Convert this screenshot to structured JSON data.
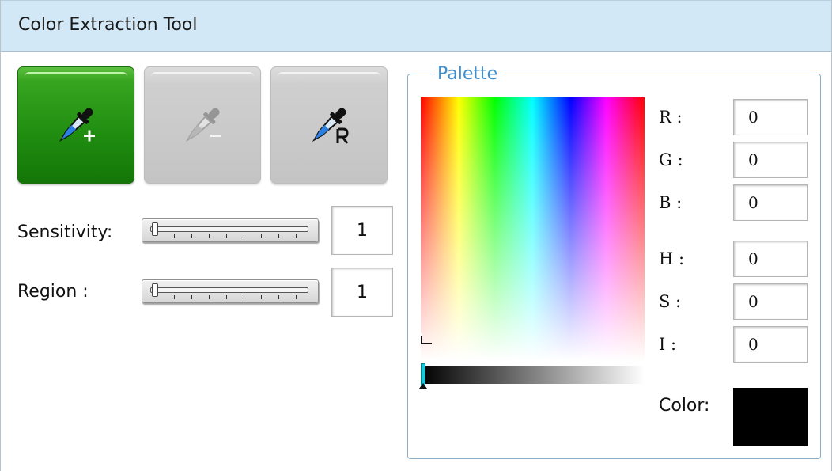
{
  "window": {
    "title": "Color Extraction Tool"
  },
  "tools": [
    {
      "id": "add",
      "icon": "eyedropper-plus-icon",
      "state": "active"
    },
    {
      "id": "remove",
      "icon": "eyedropper-minus-icon",
      "state": "disabled"
    },
    {
      "id": "reset",
      "icon": "eyedropper-reset-icon",
      "state": "enabled"
    }
  ],
  "sensitivity": {
    "label": "Sensitivity:",
    "value": "1"
  },
  "region": {
    "label": "Region :",
    "value": "1"
  },
  "palette": {
    "legend": "Palette",
    "channels": {
      "r": {
        "label": "R :",
        "value": "0"
      },
      "g": {
        "label": "G :",
        "value": "0"
      },
      "b": {
        "label": "B :",
        "value": "0"
      },
      "h": {
        "label": "H :",
        "value": "0"
      },
      "s": {
        "label": "S :",
        "value": "0"
      },
      "i": {
        "label": "I :",
        "value": "0"
      }
    },
    "color_label": "Color:",
    "color_value": "#000000"
  },
  "colors": {
    "titlebar": "#d3e8f7",
    "active_button": "#1f8c10",
    "palette_border": "#8aaec8",
    "legend_text": "#3d8fcf",
    "intensity_marker": "#19c8d9"
  }
}
